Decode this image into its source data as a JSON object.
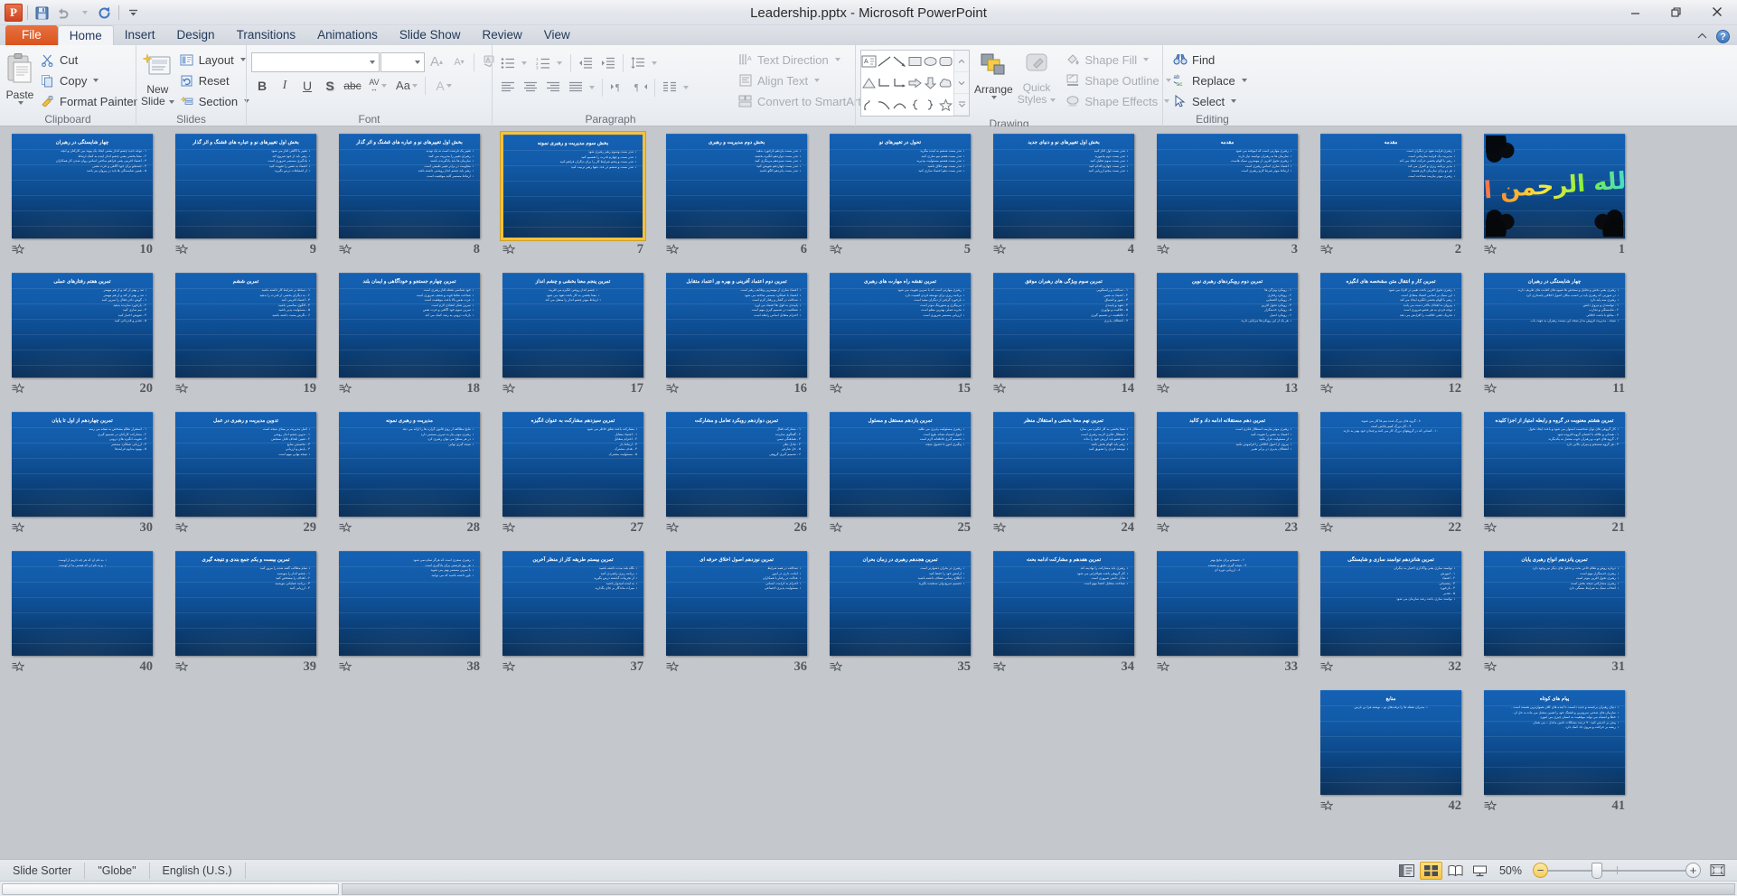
{
  "window": {
    "title": "Leadership.pptx - Microsoft PowerPoint",
    "app_icon": "powerpoint-icon",
    "minimize_label": "—",
    "restore_label": "❐",
    "close_label": "✕"
  },
  "quick_access": {
    "save_label": "save-icon",
    "undo_label": "undo-icon",
    "redo_label": "redo-icon",
    "customize_label": "customize-icon"
  },
  "tabs": [
    {
      "label": "File",
      "id": "file"
    },
    {
      "label": "Home",
      "id": "home"
    },
    {
      "label": "Insert",
      "id": "insert"
    },
    {
      "label": "Design",
      "id": "design"
    },
    {
      "label": "Transitions",
      "id": "transitions"
    },
    {
      "label": "Animations",
      "id": "animations"
    },
    {
      "label": "Slide Show",
      "id": "slideshow"
    },
    {
      "label": "Review",
      "id": "review"
    },
    {
      "label": "View",
      "id": "view"
    }
  ],
  "tab_right": {
    "minimize_ribbon": "chevron-up-icon",
    "help": "?"
  },
  "ribbon": {
    "clipboard": {
      "title": "Clipboard",
      "paste": "Paste",
      "cut": "Cut",
      "copy": "Copy",
      "format_painter": "Format Painter"
    },
    "slides": {
      "title": "Slides",
      "new_slide": "New\nSlide",
      "new_slide_line1": "New",
      "new_slide_line2": "Slide",
      "layout": "Layout",
      "reset": "Reset",
      "section": "Section"
    },
    "font": {
      "title": "Font",
      "font_name_value": "",
      "font_size_value": "",
      "grow_font": "A",
      "shrink_font": "A",
      "clear_formatting": "clear-formatting-icon",
      "bold": "B",
      "italic": "I",
      "underline": "U",
      "shadow": "S",
      "strikethrough": "abc",
      "character_spacing": "AV",
      "change_case": "Aa",
      "font_color": "A"
    },
    "paragraph": {
      "title": "Paragraph",
      "bullets": "bullets-icon",
      "numbering": "numbering-icon",
      "decrease_indent": "decrease-indent-icon",
      "increase_indent": "increase-indent-icon",
      "line_spacing": "line-spacing-icon",
      "align_left": "align-left-icon",
      "center": "align-center-icon",
      "align_right": "align-right-icon",
      "justify": "justify-icon",
      "ltr": "left-to-right-icon",
      "rtl": "right-to-left-icon",
      "columns": "columns-icon",
      "text_direction": "Text Direction",
      "align_text": "Align Text",
      "convert_to_smartart": "Convert to SmartArt"
    },
    "drawing": {
      "title": "Drawing",
      "arrange": "Arrange",
      "quick_styles_line1": "Quick",
      "quick_styles_line2": "Styles",
      "shape_fill": "Shape Fill",
      "shape_outline": "Shape Outline",
      "shape_effects": "Shape Effects",
      "shapes": [
        "textbox",
        "line",
        "arrow",
        "rectangle",
        "oval",
        "rounded-rectangle",
        "triangle",
        "elbow-connector",
        "elbow-arrow-connector",
        "right-arrow",
        "down-arrow",
        "cloud",
        "freeform",
        "curve",
        "arc",
        "left-brace",
        "right-brace",
        "star"
      ]
    },
    "editing": {
      "title": "Editing",
      "find": "Find",
      "replace": "Replace",
      "select": "Select"
    }
  },
  "status": {
    "view_name": "Slide Sorter",
    "theme": "\"Globe\"",
    "language": "English (U.S.)",
    "view_normal": "normal-view-icon",
    "view_sorter": "slide-sorter-view-icon",
    "view_reading": "reading-view-icon",
    "view_slideshow": "slide-show-view-icon",
    "zoom_percent": "50%",
    "zoom_out": "−",
    "zoom_in": "+",
    "fit_to_window": "fit-slide-to-window-icon"
  },
  "slide_sorter": {
    "selected_slide": 7,
    "columns": 10,
    "slides": [
      {
        "number": 1,
        "kind": "calligraphy",
        "title": "بسم الله الرحمن الرحيم",
        "lines": []
      },
      {
        "number": 2,
        "kind": "text",
        "title": "مقدمه",
        "lines": [
          "رهبری فرایند نفوذ در دیگران است",
          "مدیریت یک فرایند سازمانی است",
          "رهبر با الهام بخشی حرکت ایجاد می کند",
          "مدیر برنامه ریزی و کنترل می کند",
          "هر دو برای سازمان لازم هستند",
          "رهبری موثر نیازمند شناخت است"
        ]
      },
      {
        "number": 3,
        "kind": "text",
        "title": "مقدمه",
        "lines": [
          "رهبری مهارتی است که آموخته می شود",
          "سازمان ها به رهبران توانمند نیاز دارند",
          "رهبری تحول آفرین از مهمترین سبک هاست",
          "اعتماد سازی اساس رهبری است",
          "ارتباط موثر شرط لازم رهبری است"
        ]
      },
      {
        "number": 4,
        "kind": "text",
        "title": "بخش اول تغییرهای نو و دنیای جدید",
        "lines": [
          "تندر بست اول آغاز کنید",
          "تندر بست دوم بیاموزید",
          "تندر بست سوم تحلیل کنید",
          "تندر بست چهارم اقدام کنید",
          "تندر بست پنجم ارزیابی کنید"
        ]
      },
      {
        "number": 5,
        "kind": "text",
        "title": "تحول در تغییرهای نو",
        "lines": [
          "تندر بست ششم به آینده بنگرید",
          "تندر بست هفتم تیم سازی کنید",
          "تندر بست هشتم مسئولیت بپذیرید",
          "تندر بست نهم خلاق باشید",
          "تندر بست دهم اعتماد سازی کنید"
        ]
      },
      {
        "number": 6,
        "kind": "text",
        "title": "بخش دوم مدیریت و رهبری",
        "lines": [
          "تندر بست یازدهم بازخورد بدهید",
          "تندر بست دوازدهم انگیزه بخشید",
          "تندر بست سیزدهم مربیگری کنید",
          "تندر بست چهاردهم تفویض کنید",
          "تندر بست پانزدهم الگو باشید"
        ]
      },
      {
        "number": 7,
        "kind": "text",
        "title": "بخش سوم مدیریت و رهبری نمونه",
        "selected": true,
        "lines": [
          "تندر بست وسوم رهبر رهبری شود",
          "تندر بست و چهارم قدرت را تقسیم کنید",
          "تندر بست و پنجم شرایط کار را برای دیگران فراهم کنید",
          "تندر بست و ششم در عدد دهها رهبر تربیت کنید"
        ]
      },
      {
        "number": 8,
        "kind": "text",
        "title": "بخش اول تغییرهای نو و عباره های قشنگ و اثر گذار",
        "lines": [
          "تغییر یک فرصت است نه یک تهدید",
          "رهبران تغییر را مدیریت می کنند",
          "سازمان ها باید یادگیرنده باشند",
          "مقاومت در برابر تغییر طبیعی است",
          "رهبر باید چشم انداز روشنی داشته باشد",
          "ارتباط مستمر کلید موفقیت است"
        ]
      },
      {
        "number": 9,
        "kind": "text",
        "title": "بخش اول تغییرهای نو و عباره های قشنگ و اثر گذار",
        "lines": [
          "تغییر با آگاهی آغاز می شود",
          "رهبر باید از خود شروع کند",
          "یادگیری مستمر ضروری است",
          "اعتماد به نفس را تقویت کنید",
          "از اشتباهات درس بگیرید"
        ]
      },
      {
        "number": 10,
        "kind": "text",
        "title": "چهار شایستگی در رهبران",
        "lines": [
          "۱ - توجه جدید چشم انداز یشنی ایجاد یک پیوند بین کارکنان و آنچه",
          "۲ - معنا بخشی یعنی چشم انداز آینده به کمک ارتباط",
          "۳ - اعتماد آفرینی یعنی فراهم ساختن اساس روان شدن کار همکاران",
          "۴ - جستجو برای خود آگاهی و عزت نفس",
          "۵ - همین شایستگی ها باید در پیروان نیز باشد"
        ]
      },
      {
        "number": 11,
        "kind": "text",
        "title": "چهار شایستگی در رهبران",
        "lines": [
          "رهبری یعنی بخش و تحلیل و سنجش ها شیوه های کفایت های ظریف دارند",
          "در صورتی که رهبری باید بر حسب مکان اصول اخلاقی پاسداری کرد",
          "رهبری سه پایه دارد",
          "۱ - توانمندی و نیروی دانش",
          "۲ - شایستگی و تجارب",
          "۳ - منافع با باعث اخلاقی",
          "نتیجه - مدیریت فروش مدار نتیجه این نیست رهبران به جهت باب"
        ]
      },
      {
        "number": 12,
        "kind": "text",
        "title": "تمرین کار و انتقال متن مشخصه های انگیزه",
        "lines": [
          "رهبری تحول آفرین باعث تغییر در افراد می شود",
          "این سبک بر اساس اعتماد متقابل است",
          "رهبر با الهام بخشی انگیزه ایجاد می کند",
          "پیروان به اهداف بالاتر دست می یابند",
          "توجه فردی به هر عضو ضروری است",
          "تحریک ذهنی خلاقیت را افزایش می دهد"
        ]
      },
      {
        "number": 13,
        "kind": "text",
        "title": "تمرین دوم رویکردهای رهبری نوین",
        "lines": [
          "۱ - رویکرد ویژگی ها",
          "۲ - رویکرد رفتاری",
          "۳ - رویکرد اقتضایی",
          "۴ - رویکرد تحول آفرین",
          "۵ - رویکرد خدمتگزار",
          "۶ - رویکرد اصیل",
          "هر یک از این رویکردها مزایایی دارند"
        ]
      },
      {
        "number": 14,
        "kind": "text",
        "title": "تمرین سوم ویژگی های رهبران موفق",
        "lines": [
          "۱ - صداقت و راستگویی",
          "۲ - اعتماد به نفس",
          "۳ - شور و اشتیاق",
          "۴ - تعهد و پایبندی",
          "۵ - خلاقیت و نوآوری",
          "۶ - قاطعیت در تصمیم گیری",
          "۷ - انعطاف پذیری"
        ]
      },
      {
        "number": 15,
        "kind": "text",
        "title": "تمرین نقشه راه مهارت های رهبری",
        "lines": [
          "رهبری مهارتی است که با تمرین تقویت می شود",
          "برنامه ریزی برای توسعه فردی اهمیت دارد",
          "بازخورد گرفتن از دیگران مفید است",
          "مربیگری و منتورینگ موثر است",
          "تجربه عملی بهترین معلم است",
          "ارزیابی مستمر ضروری است"
        ]
      },
      {
        "number": 16,
        "kind": "text",
        "title": "تمرین دوم اعتماد آفرینی و بهره ور اعتماد متقابل",
        "lines": [
          "اعتماد سازی از مهمترین وظایف رهبر است",
          "اعتماد با عملکرد مستمر ساخته می شود",
          "صداقت در گفتار و رفتار لازم است",
          "پایبندی به قول ها اعتماد می آورد",
          "شفافیت در تصمیم گیری مهم است",
          "احترام متقابل اساس رابطه است"
        ]
      },
      {
        "number": 17,
        "kind": "text",
        "title": "تمرین پنجم معنا بخشی و چشم انداز",
        "lines": [
          "چشم انداز روشن انگیزه می آفریند",
          "معنا بخشی به کار باعث تعهد می شود",
          "ارتباط موثر چشم انداز را منتقل می کند"
        ]
      },
      {
        "number": 18,
        "kind": "text",
        "title": "تمرین چهارم جستجو و خودآگاهی و ایمان بلند",
        "lines": [
          "خود شناسی نقطه آغاز رهبری است",
          "شناخت نقاط قوت و ضعف ضروری است",
          "عزت نفس بالا باعث موفقیت است",
          "تمرین تفکر انتقادی لازم است",
          "تمرین سوم خود آگاهی و عزت نفس",
          "بازتاب درونی به رشد کمک می کند"
        ]
      },
      {
        "number": 19,
        "kind": "text",
        "title": "تمرین ششم",
        "lines": [
          "۱ - تسلط بر شرایط کار داشته باشید",
          "۲ - به دیگران بخشی از قدرت را بدهید",
          "۳ - اعتماد آفرینی کنید",
          "۴ - الگوی مناسبی باشید",
          "۵ - مسئولیت پذیر باشید",
          "۶ - نگرش مثبت داشته باشید"
        ]
      },
      {
        "number": 20,
        "kind": "text",
        "title": "تمرین هفتم رفتارهای عملی",
        "lines": [
          "تند ر بهتر از کند و از هم مهمتر",
          "تند ر بهتر از کند و از هم مهمتر",
          "۱ - گوش دادن فعال را تمرین کنید",
          "۲ - بازخورد سازنده بدهید",
          "۳ - تیم سازی کنید",
          "۴ - تفویض اختیار کنید",
          "۵ - تقدیر و قدردانی کنید"
        ]
      },
      {
        "number": 21,
        "kind": "text",
        "title": "تمرین هشتم معنویت در گروه و رابطه امتیاز از اجزا کلیده",
        "lines": [
          "کار گروهی های توان شخصیت استوار می شود و باعث ایجاد تحول",
          "۱ - همدلی و علاقه با اعضای گروه افزوده شود",
          "۲ - گروه های خوب و رهبران خوب متصل به یکدیگرند",
          "۳ - هر گروه منسجم و میزان بالایی دارد"
        ]
      },
      {
        "number": 22,
        "kind": "text",
        "title": "",
        "lines": [
          "۸ - گروه های بزرگ شده تیم ها کار می شوند",
          "۹ - کار بزرگ کنیم پاداش است",
          "۱۰ - کسانی که در گروههای بزرگ کار می کنند و چندان خود بهتر به دازند"
        ]
      },
      {
        "number": 23,
        "kind": "text",
        "title": "تمرین دهم مستقلانه ادامه داد و کالبد",
        "lines": [
          "رهبری موثر نیازمند استقلال فکری است",
          "اعتماد به نفس را تقویت کنید",
          "از مسئولیت فرار نکنید",
          "پیروی از اصول اخلاقی را فراموش نکنید",
          "انعطاف پذیری در برابر تغییر"
        ]
      },
      {
        "number": 24,
        "kind": "text",
        "title": "تمرین نهم معنا بخشی و استقلال منظر",
        "lines": [
          "معنا بخشی به کار انگیزه می سازد",
          "استقلال فکری لازمه رهبری است",
          "هر عضو باید ارزش خود را بداند",
          "رهبر باید الهام بخش باشد",
          "توسعه فردی را تشویق کنید"
        ]
      },
      {
        "number": 25,
        "kind": "text",
        "title": "تمرین یازدهم مستقل و مسئول",
        "lines": [
          "رهبری مسئولیت پذیری می طلبد",
          "قبول اشتباه نشانه بلوغ است",
          "تصمیم گیری قاطعانه لازم است",
          "پیگیری امور تا حصول نتیجه"
        ]
      },
      {
        "number": 26,
        "kind": "text",
        "title": "تمرین دوازدهم رویکرد تعامل و مشارکت",
        "lines": [
          "۱ - مشارکت فعال",
          "۲ - گفتگوی سازنده",
          "۳ - هماهنگی تیمی",
          "۴ - تبادل نظر",
          "۵ - حل تعارض",
          "۶ - تصمیم گیری گروهی"
        ]
      },
      {
        "number": 27,
        "kind": "text",
        "title": "تمرین سیزدهم مشارکت به عنوان انگیزه",
        "lines": [
          "مشارکت باعث تعلق خاطر می شود",
          "۱ - اعتماد متقابل",
          "۲ - احترام متقابل",
          "۳ - ارتباط باز",
          "۴ - هدف مشترک",
          "۵ - مسئولیت مشترک"
        ]
      },
      {
        "number": 28,
        "kind": "text",
        "title": "مدیریت و رهبری نمونه",
        "lines": [
          "نتایج مطالعه از روی قانون گزاره ها را ارائه می دهد",
          "رهبری موثر نیاز به تمرین مستمر دارد",
          "در هر سطح می توان رهبری کرد",
          "نتیجه گیری نهایی"
        ]
      },
      {
        "number": 29,
        "kind": "text",
        "title": "تدوین مدیریت و رهبری در عمل",
        "lines": [
          "اصل مدیریت بر مبنای نتیجه است",
          "۱ - تدوین چشم انداز روشن",
          "۲ - تعیین اهداف قابل سنجش",
          "۳ - تخصیص منابع",
          "۴ - پایش و ارزیابی",
          "نتیجه نهایی مهم است"
        ]
      },
      {
        "number": 30,
        "kind": "text",
        "title": "تمرین چهاردهم از اول تا پایان",
        "lines": [
          "۱ - استقرار نظام مشخص به نتیجه می رسد",
          "۲ - مشارکت کارکنان در تصمیم گیری",
          "۳ - تقویت انگیزه های درونی",
          "۴ - ارزیابی عملکرد مستمر",
          "۵ - بهبود مداوم فرآیندها"
        ]
      },
      {
        "number": 31,
        "kind": "text",
        "title": "تمرین پانزدهم انواع رهبری پایان",
        "lines": [
          "درباره روش و نظام خاص بحث و تحلیل های دیگر نیز وجود دارد",
          "رهبری خدمتگزار مهم است",
          "رهبری تحول آفرین موثر است",
          "رهبری مشارکتی نتیجه بخش است",
          "انتخاب سبک به شرایط بستگی دارد"
        ]
      },
      {
        "number": 32,
        "kind": "text",
        "title": "تمرین شانزدهم توانمند سازی و شایستگی",
        "lines": [
          "توانمند سازی یعنی واگذاری اختیار به دیگران",
          "۱ - آموزش",
          "۲ - اعتماد",
          "۳ - پشتیبانی",
          "۴ - بازخورد",
          "۵ - تقدیر",
          "توانمند سازی باعث رشد سازمان می شود"
        ]
      },
      {
        "number": 33,
        "kind": "text",
        "title": "",
        "lines": [
          "۶ - جستجو برای نتایج بهتر",
          "۷ - نتیجه گیری دقیق و مستند",
          "۸ - ارزیابی دوره ای"
        ]
      },
      {
        "number": 34,
        "kind": "text",
        "title": "تمرین هفدهم و مشارکت ادامه بحث",
        "lines": [
          "رهبری باید مشارکت را نهادینه کند",
          "کار گروهی باعث هم‌افزایی می شود",
          "تبادل دانش ضروری است",
          "شناخت متقابل اعضا مهم است"
        ]
      },
      {
        "number": 35,
        "kind": "text",
        "title": "تمرین هجدهم رهبری در زمان بحران",
        "lines": [
          "رهبری در بحران دشوارتر است",
          "آرامش خود را حفظ کنید",
          "اطلاع رسانی شفاف داشته باشید",
          "تصمیم سریع ولی سنجیده بگیرید"
        ]
      },
      {
        "number": 36,
        "kind": "text",
        "title": "تمرین نوزدهم اصول اخلاق حرفه ای",
        "lines": [
          "صداقت در همه شرایط",
          "امانت داری در امور",
          "عدالت در رفتار با همکاران",
          "احترام به کرامت انسانی",
          "مسئولیت پذیری اجتماعی"
        ]
      },
      {
        "number": 37,
        "kind": "text",
        "title": "تمرین بیستم طریقه کار از منظر آخرین",
        "lines": [
          "نگاه بلند مدت داشته باشید",
          "برنامه ریزی راهبردی کنید",
          "از تجربیات گذشته درس بگیرید",
          "به آینده امیدوار باشید",
          "میراث ماندگار بر جای بگذارید"
        ]
      },
      {
        "number": 38,
        "kind": "text",
        "title": "",
        "lines": [
          "رهبری سفری است که هرگز تمام نمی شود",
          "هر روز فرصتی برای یادگیری است",
          "با تمرین مستمر بهتر می شوید",
          "باور داشته باشید که می توانید"
        ]
      },
      {
        "number": 39,
        "kind": "text",
        "title": "تمرین بیست و یکم جمع بندی و نتیجه گیری",
        "lines": [
          "تمام مطالب گفته شده را مرور کنید",
          "۱ - چشم انداز را بنویسید",
          "۲ - اهداف را مشخص کنید",
          "۳ - برنامه عملیاتی بنویسید",
          "۴ - ارزیابی کنید"
        ]
      },
      {
        "number": 40,
        "kind": "text",
        "title": "",
        "lines": [
          "به نام آن که هر چه داریم از اوست",
          "و به نام آن که هستی ما از اوست"
        ]
      },
      {
        "number": 41,
        "kind": "text",
        "title": "پیام های کوتاه",
        "lines": [
          "دنیای رهبران برجسته و جدید دانست نا آینده های کلان هموارترین هستند است .",
          "سازمان های صحنی سروترین و قشنگ خود را همین مشتل می ماند به حل آن .",
          "خطا و اشتباه می تواند موفقیت به انسان چیزی می آموزد .",
          "پیش بر اندیس کنید ۹۰ درصد مشکلات تامین ماندل – می همان",
          "ریشه بر حرافت و نیروی داد کمک دارد ."
        ]
      },
      {
        "number": 42,
        "kind": "text",
        "title": "منابع",
        "lines": [
          "مدیران نقطه ها را ترفندهای تو – نوشته هرا بن بارس"
        ]
      }
    ]
  }
}
